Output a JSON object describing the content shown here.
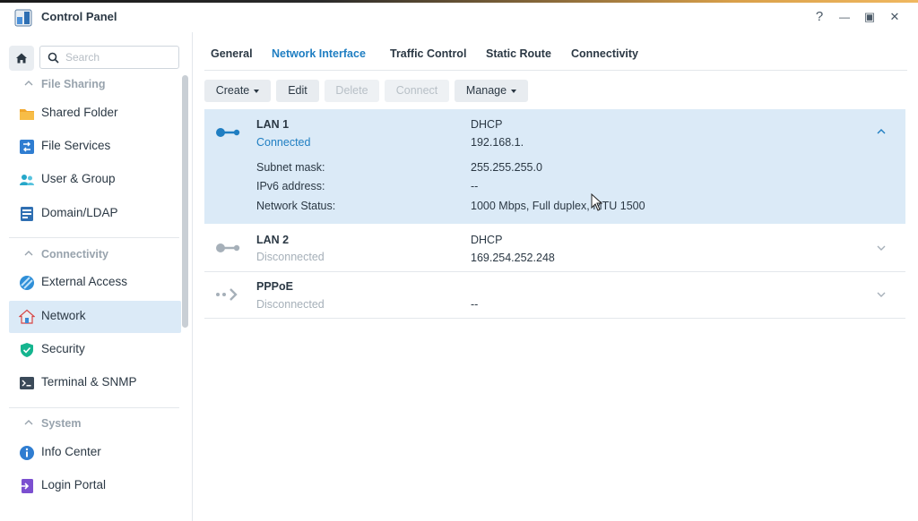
{
  "window": {
    "title": "Control Panel",
    "help": "?",
    "minimize": "—",
    "maximize": "▣",
    "close": "✕"
  },
  "sidebar": {
    "search_placeholder": "Search",
    "sections": [
      {
        "title": "File Sharing",
        "items": [
          "Shared Folder",
          "File Services",
          "User & Group",
          "Domain/LDAP"
        ]
      },
      {
        "title": "Connectivity",
        "items": [
          "External Access",
          "Network",
          "Security",
          "Terminal & SNMP"
        ]
      },
      {
        "title": "System",
        "items": [
          "Info Center",
          "Login Portal"
        ]
      }
    ],
    "active_item": "Network"
  },
  "tabs": [
    "General",
    "Network Interface",
    "Traffic Control",
    "Static Route",
    "Connectivity"
  ],
  "active_tab": "Network Interface",
  "toolbar": {
    "create": "Create",
    "edit": "Edit",
    "delete": "Delete",
    "connect": "Connect",
    "manage": "Manage"
  },
  "interfaces": [
    {
      "name": "LAN 1",
      "status": "Connected",
      "mode": "DHCP",
      "ip": "192.168.1.",
      "details": [
        {
          "label": "Subnet mask:",
          "value": "255.255.255.0"
        },
        {
          "label": "IPv6 address:",
          "value": "--"
        },
        {
          "label": "Network Status:",
          "value": "1000 Mbps, Full duplex, MTU 1500"
        }
      ]
    },
    {
      "name": "LAN 2",
      "status": "Disconnected",
      "mode": "DHCP",
      "ip": "169.254.252.248"
    },
    {
      "name": "PPPoE",
      "status": "Disconnected",
      "mode": "",
      "ip": "--"
    }
  ],
  "colors": {
    "accent": "#1f7ec2",
    "selected_bg": "#dbeaf7",
    "muted": "#a6b0b9"
  }
}
